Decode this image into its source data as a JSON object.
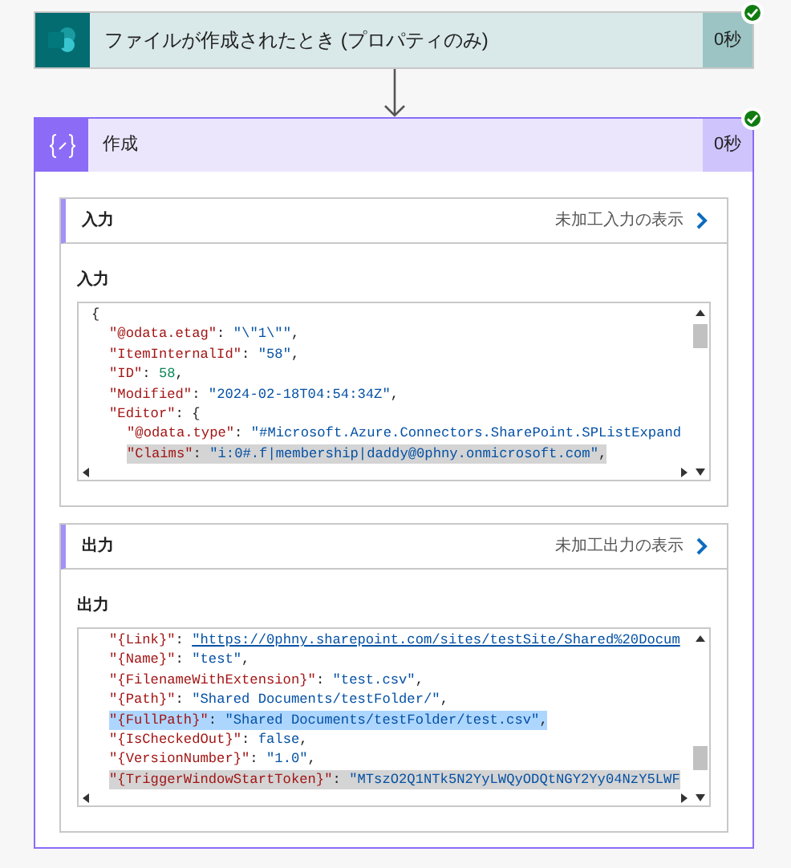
{
  "trigger": {
    "title": "ファイルが作成されたとき (プロパティのみ)",
    "duration": "0秒",
    "succeeded": true
  },
  "action": {
    "title": "作成",
    "duration": "0秒",
    "succeeded": true,
    "sections": [
      {
        "heading": "入力",
        "link": "未加工入力の表示",
        "field_label": "入力",
        "code": [
          {
            "selected": false,
            "tokens": [
              {
                "kind": "punct",
                "text": "{"
              }
            ],
            "children": [
              {
                "selected": false,
                "tokens": [
                  {
                    "kind": "key",
                    "text": "\"@odata.etag\""
                  },
                  {
                    "kind": "punct",
                    "text": ": "
                  },
                  {
                    "kind": "string",
                    "text": "\"\\\"1\\\"\""
                  },
                  {
                    "kind": "punct",
                    "text": ","
                  }
                ]
              },
              {
                "selected": false,
                "tokens": [
                  {
                    "kind": "key",
                    "text": "\"ItemInternalId\""
                  },
                  {
                    "kind": "punct",
                    "text": ": "
                  },
                  {
                    "kind": "string",
                    "text": "\"58\""
                  },
                  {
                    "kind": "punct",
                    "text": ","
                  }
                ]
              },
              {
                "selected": false,
                "tokens": [
                  {
                    "kind": "key",
                    "text": "\"ID\""
                  },
                  {
                    "kind": "punct",
                    "text": ": "
                  },
                  {
                    "kind": "number",
                    "text": "58"
                  },
                  {
                    "kind": "punct",
                    "text": ","
                  }
                ]
              },
              {
                "selected": false,
                "tokens": [
                  {
                    "kind": "key",
                    "text": "\"Modified\""
                  },
                  {
                    "kind": "punct",
                    "text": ": "
                  },
                  {
                    "kind": "string",
                    "text": "\"2024-02-18T04:54:34Z\""
                  },
                  {
                    "kind": "punct",
                    "text": ","
                  }
                ]
              },
              {
                "selected": false,
                "tokens": [
                  {
                    "kind": "key",
                    "text": "\"Editor\""
                  },
                  {
                    "kind": "punct",
                    "text": ": {"
                  }
                ],
                "children": [
                  {
                    "selected": false,
                    "tokens": [
                      {
                        "kind": "key",
                        "text": "\"@odata.type\""
                      },
                      {
                        "kind": "punct",
                        "text": ": "
                      },
                      {
                        "kind": "string",
                        "text": "\"#Microsoft.Azure.Connectors.SharePoint.SPListExpand"
                      }
                    ]
                  },
                  {
                    "selected": true,
                    "focused": false,
                    "tokens": [
                      {
                        "kind": "key",
                        "text": "\"Claims\""
                      },
                      {
                        "kind": "punct",
                        "text": ": "
                      },
                      {
                        "kind": "string",
                        "text": "\"i:0#.f|membership|daddy@0phny.onmicrosoft.com\""
                      },
                      {
                        "kind": "punct",
                        "text": ","
                      }
                    ]
                  }
                ]
              }
            ]
          }
        ]
      },
      {
        "heading": "出力",
        "link": "未加工出力の表示",
        "field_label": "出力",
        "code": [
          {
            "children": [
              {
                "selected": false,
                "tokens": [
                  {
                    "kind": "key",
                    "text": "\"{Link}\""
                  },
                  {
                    "kind": "punct",
                    "text": ": "
                  },
                  {
                    "kind": "link",
                    "text": "\"https://0phny.sharepoint.com/sites/testSite/Shared%20Docum"
                  }
                ]
              },
              {
                "selected": false,
                "tokens": [
                  {
                    "kind": "key",
                    "text": "\"{Name}\""
                  },
                  {
                    "kind": "punct",
                    "text": ": "
                  },
                  {
                    "kind": "string",
                    "text": "\"test\""
                  },
                  {
                    "kind": "punct",
                    "text": ","
                  }
                ]
              },
              {
                "selected": false,
                "tokens": [
                  {
                    "kind": "key",
                    "text": "\"{FilenameWithExtension}\""
                  },
                  {
                    "kind": "punct",
                    "text": ": "
                  },
                  {
                    "kind": "string",
                    "text": "\"test.csv\""
                  },
                  {
                    "kind": "punct",
                    "text": ","
                  }
                ]
              },
              {
                "selected": false,
                "tokens": [
                  {
                    "kind": "key",
                    "text": "\"{Path}\""
                  },
                  {
                    "kind": "punct",
                    "text": ": "
                  },
                  {
                    "kind": "string",
                    "text": "\"Shared Documents/testFolder/\""
                  },
                  {
                    "kind": "punct",
                    "text": ","
                  }
                ]
              },
              {
                "selected": true,
                "focused": true,
                "tokens": [
                  {
                    "kind": "key",
                    "text": "\"{FullPath}\""
                  },
                  {
                    "kind": "punct",
                    "text": ": "
                  },
                  {
                    "kind": "string",
                    "text": "\"Shared Documents/testFolder/test.csv\""
                  },
                  {
                    "kind": "punct",
                    "text": ","
                  }
                ]
              },
              {
                "selected": false,
                "tokens": [
                  {
                    "kind": "key",
                    "text": "\"{IsCheckedOut}\""
                  },
                  {
                    "kind": "punct",
                    "text": ": "
                  },
                  {
                    "kind": "keyword",
                    "text": "false"
                  },
                  {
                    "kind": "punct",
                    "text": ","
                  }
                ]
              },
              {
                "selected": false,
                "tokens": [
                  {
                    "kind": "key",
                    "text": "\"{VersionNumber}\""
                  },
                  {
                    "kind": "punct",
                    "text": ": "
                  },
                  {
                    "kind": "string",
                    "text": "\"1.0\""
                  },
                  {
                    "kind": "punct",
                    "text": ","
                  }
                ]
              },
              {
                "selected": true,
                "focused": false,
                "tokens": [
                  {
                    "kind": "key",
                    "text": "\"{TriggerWindowStartToken}\""
                  },
                  {
                    "kind": "punct",
                    "text": ": "
                  },
                  {
                    "kind": "string",
                    "text": "\"MTszO2Q1NTk5N2YyLWQyODQtNGY2Yy04NzY5LWF"
                  }
                ]
              }
            ]
          }
        ]
      }
    ]
  }
}
